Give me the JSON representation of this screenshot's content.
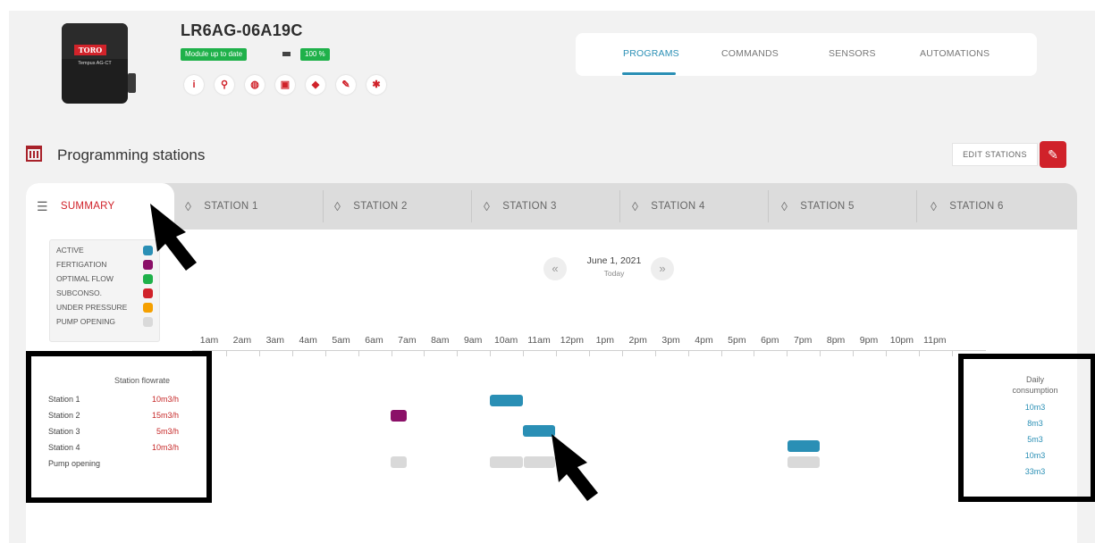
{
  "device": {
    "name": "LR6AG-06A19C",
    "module_status": "Module up to date",
    "battery": "100 %",
    "logo_text": "TORO",
    "model_text": "Tempus AG-CT"
  },
  "top_tabs": [
    {
      "label": "PROGRAMS",
      "active": true
    },
    {
      "label": "COMMANDS",
      "active": false
    },
    {
      "label": "SENSORS",
      "active": false
    },
    {
      "label": "AUTOMATIONS",
      "active": false
    }
  ],
  "section": {
    "title": "Programming stations",
    "edit_label": "EDIT STATIONS"
  },
  "station_tabs": [
    {
      "label": "SUMMARY",
      "active": true
    },
    {
      "label": "STATION 1"
    },
    {
      "label": "STATION 2"
    },
    {
      "label": "STATION 3"
    },
    {
      "label": "STATION 4"
    },
    {
      "label": "STATION 5"
    },
    {
      "label": "STATION 6"
    }
  ],
  "legend": [
    {
      "label": "ACTIVE",
      "color": "#2a8fb5"
    },
    {
      "label": "FERTIGATION",
      "color": "#8b1068"
    },
    {
      "label": "OPTIMAL FLOW",
      "color": "#1fb14a"
    },
    {
      "label": "SUBCONSO.",
      "color": "#d0222a"
    },
    {
      "label": "UNDER PRESSURE",
      "color": "#f5a000"
    },
    {
      "label": "PUMP OPENING",
      "color": "#d9d9d9"
    }
  ],
  "date_nav": {
    "prev": "«",
    "next": "»",
    "date": "June 1, 2021",
    "sub": "Today"
  },
  "hours": [
    "1am",
    "2am",
    "3am",
    "4am",
    "5am",
    "6am",
    "7am",
    "8am",
    "9am",
    "10am",
    "11am",
    "12pm",
    "1pm",
    "2pm",
    "3pm",
    "4pm",
    "5pm",
    "6pm",
    "7pm",
    "8pm",
    "9pm",
    "10pm",
    "11pm"
  ],
  "flowrate": {
    "title": "Station flowrate",
    "rows": [
      {
        "name": "Station 1",
        "value": "10m3/h"
      },
      {
        "name": "Station 2",
        "value": "15m3/h"
      },
      {
        "name": "Station 3",
        "value": "5m3/h"
      },
      {
        "name": "Station 4",
        "value": "10m3/h"
      },
      {
        "name": "Pump opening",
        "value": ""
      }
    ]
  },
  "daily": {
    "title_line1": "Daily",
    "title_line2": "consumption",
    "values": [
      "10m3",
      "8m3",
      "5m3",
      "10m3",
      "33m3"
    ]
  }
}
